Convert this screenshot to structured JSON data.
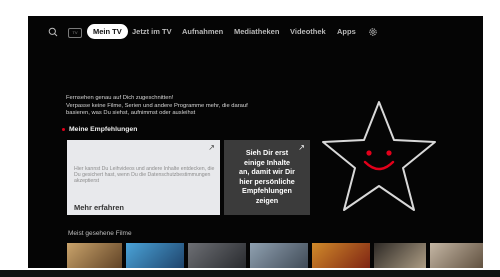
{
  "nav": {
    "tv_badge": "TV",
    "items": [
      "Mein TV",
      "Jetzt im TV",
      "Aufnahmen",
      "Mediatheken",
      "Videothek",
      "Apps"
    ]
  },
  "intro": {
    "line1": "Fernsehen genau auf Dich zugeschnitten!",
    "line2": "Verpasse keine Filme, Serien und andere Programme mehr, die darauf",
    "line3": "basieren, was Du siehst, aufnimmst oder ausleihst"
  },
  "recommendations": {
    "title": "Meine Empfehlungen",
    "privacy_card": {
      "text": "Hier kannst Du Leihvideos und andere Inhalte entdecken, die Du gesichert hast, wenn Du die Datenschutzbestimmungen akzeptierst",
      "cta": "Mehr erfahren"
    },
    "info_card": {
      "line1": "Sieh Dir erst",
      "line2": "einige Inhalte",
      "line3": "an, damit wir Dir",
      "line4": "hier persönliche",
      "line5": "Empfehlungen",
      "line6": "zeigen"
    }
  },
  "most_watched": {
    "title": "Meist gesehene Filme"
  },
  "colors": {
    "accent": "#e2001a",
    "background": "#050505",
    "card_light": "#e8e9ec",
    "card_dark": "#3b3b3b"
  },
  "icons": [
    "search-icon",
    "tv-icon",
    "settings-gear-icon",
    "arrow-up-right-icon",
    "smiley-star-icon"
  ]
}
